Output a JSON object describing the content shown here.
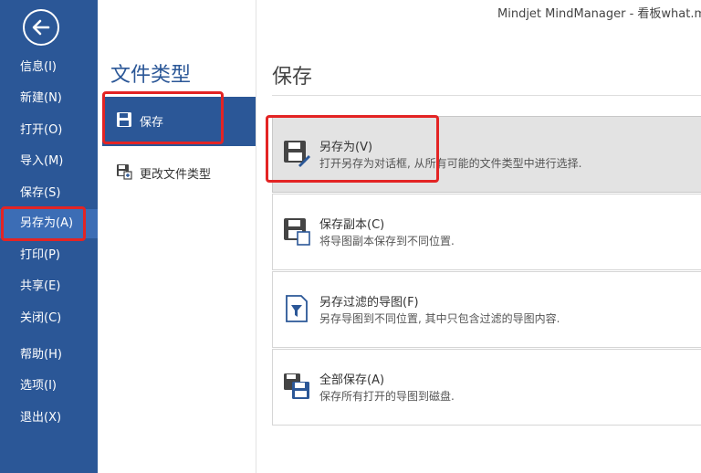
{
  "window": {
    "title": "Mindjet MindManager - 看板what.m"
  },
  "nav": {
    "items": [
      {
        "label": "信息(I)"
      },
      {
        "label": "新建(N)"
      },
      {
        "label": "打开(O)"
      },
      {
        "label": "导入(M)"
      },
      {
        "label": "保存(S)"
      },
      {
        "label": "另存为(A)",
        "selected": true
      },
      {
        "label": "打印(P)"
      },
      {
        "label": "共享(E)"
      },
      {
        "label": "关闭(C)"
      },
      {
        "label": "帮助(H)"
      },
      {
        "label": "选项(I)"
      },
      {
        "label": "退出(X)"
      }
    ]
  },
  "filetype": {
    "title": "文件类型",
    "items": [
      {
        "label": "保存",
        "icon": "floppy-disk-icon",
        "selected": true
      },
      {
        "label": "更改文件类型",
        "icon": "change-filetype-icon"
      }
    ]
  },
  "panel": {
    "title": "保存",
    "options": [
      {
        "label": "另存为(V)",
        "desc": "打开另存为对话框, 从所有可能的文件类型中进行选择.",
        "icon": "save-as-icon"
      },
      {
        "label": "保存副本(C)",
        "desc": "将导图副本保存到不同位置.",
        "icon": "save-copy-icon"
      },
      {
        "label": "另存过滤的导图(F)",
        "desc": "另存导图到不同位置, 其中只包含过滤的导图内容.",
        "icon": "save-filtered-icon"
      },
      {
        "label": "全部保存(A)",
        "desc": "保存所有打开的导图到磁盘.",
        "icon": "save-all-icon"
      }
    ]
  },
  "colors": {
    "nav_bg": "#2b5797",
    "nav_selected": "#3c6db5",
    "highlight_frame": "#e32424"
  }
}
